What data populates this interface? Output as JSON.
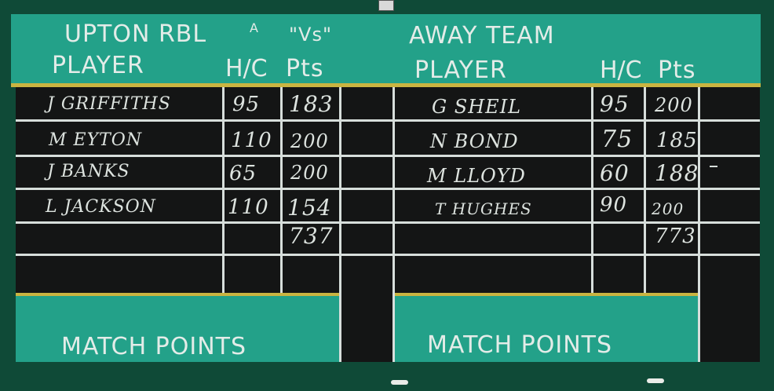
{
  "header": {
    "home_title": "UPTON RBL",
    "home_title_mark": "A",
    "vs": "\"Vs\"",
    "away_title": "AWAY TEAM"
  },
  "home": {
    "col_player": "PLAYER",
    "col_hc": "H/C",
    "col_pts": "Pts",
    "rows": [
      {
        "name": "J GRIFFITHS",
        "hc": "95",
        "pts": "183"
      },
      {
        "name": "M EYTON",
        "hc": "110",
        "pts": "200"
      },
      {
        "name": "J BANKS",
        "hc": "65",
        "pts": "200"
      },
      {
        "name": "L JACKSON",
        "hc": "110",
        "pts": "154"
      }
    ],
    "total": "737",
    "match_points_label": "MATCH POINTS"
  },
  "away": {
    "col_player": "PLAYER",
    "col_hc": "H/C",
    "col_pts": "Pts",
    "rows": [
      {
        "name": "G SHEIL",
        "hc": "95",
        "pts": "200"
      },
      {
        "name": "N BOND",
        "hc": "75",
        "pts": "185"
      },
      {
        "name": "M LLOYD",
        "hc": "60",
        "pts": "188"
      },
      {
        "name": "T HUGHES",
        "hc": "90",
        "pts": "200"
      }
    ],
    "total": "773",
    "match_points_label": "MATCH POINTS"
  }
}
